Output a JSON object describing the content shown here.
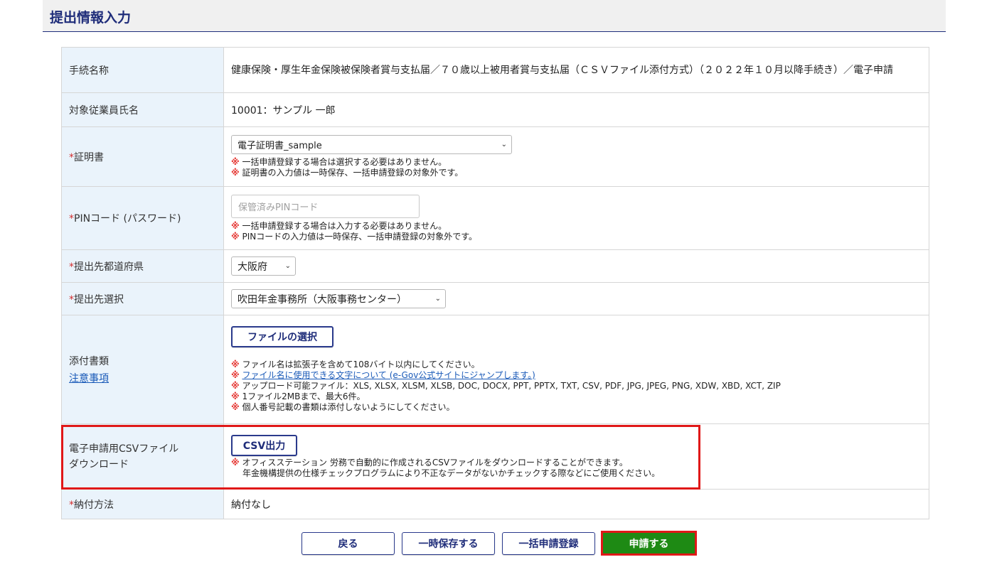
{
  "header": {
    "title": "提出情報入力"
  },
  "form": {
    "procedure": {
      "label": "手続名称",
      "value": "健康保険・厚生年金保険被保険者賞与支払届／７０歳以上被用者賞与支払届（ＣＳＶファイル添付方式）（２０２２年１０月以降手続き）／電子申請"
    },
    "employee": {
      "label": "対象従業員氏名",
      "value": "10001：サンプル 一郎"
    },
    "certificate": {
      "required_mark": "*",
      "label": "証明書",
      "selected": "電子証明書_sample",
      "note_mark": "※",
      "notes": [
        "一括申請登録する場合は選択する必要はありません。",
        "証明書の入力値は一時保存、一括申請登録の対象外です。"
      ]
    },
    "pin": {
      "required_mark": "*",
      "label": "PINコード (パスワード)",
      "placeholder": "保管済みPINコード",
      "value": "",
      "note_mark": "※",
      "notes": [
        "一括申請登録する場合は入力する必要はありません。",
        "PINコードの入力値は一時保存、一括申請登録の対象外です。"
      ]
    },
    "prefecture": {
      "required_mark": "*",
      "label": "提出先都道府県",
      "selected": "大阪府"
    },
    "office": {
      "required_mark": "*",
      "label": "提出先選択",
      "selected": "吹田年金事務所（大阪事務センター）"
    },
    "attachments": {
      "label": "添付書類",
      "caution_link": "注意事項",
      "button": "ファイルの選択",
      "note_mark": "※",
      "notes": [
        "ファイル名は拡張子を含めて108バイト以内にしてください。",
        "ファイル名に使用できる文字について (e-Gov公式サイトにジャンプします。)",
        "アップロード可能ファイル：XLS, XLSX, XLSM, XLSB, DOC, DOCX, PPT, PPTX, TXT, CSV, PDF, JPG, JPEG, PNG, XDW, XBD, XCT, ZIP",
        "1ファイル2MBまで、最大6件。",
        "個人番号記載の書類は添付しないようにしてください。"
      ]
    },
    "csv": {
      "label_line1": "電子申請用CSVファイル",
      "label_line2": "ダウンロード",
      "button": "CSV出力",
      "note_mark": "※",
      "note_line1": "オフィスステーション 労務で自動的に作成されるCSVファイルをダウンロードすることができます。",
      "note_line2": "年金機構提供の仕様チェックプログラムにより不正なデータがないかチェックする際などにご使用ください。"
    },
    "payment": {
      "required_mark": "*",
      "label": "納付方法",
      "value": "納付なし"
    }
  },
  "footer": {
    "back": "戻る",
    "save_temp": "一時保存する",
    "bulk_register": "一括申請登録",
    "apply": "申請する"
  },
  "colors": {
    "header_text": "#1f2d7a",
    "label_bg": "#eaf3fb",
    "highlight": "#e01818",
    "apply_green": "#1e8a14",
    "note_mark": "#e53935"
  }
}
